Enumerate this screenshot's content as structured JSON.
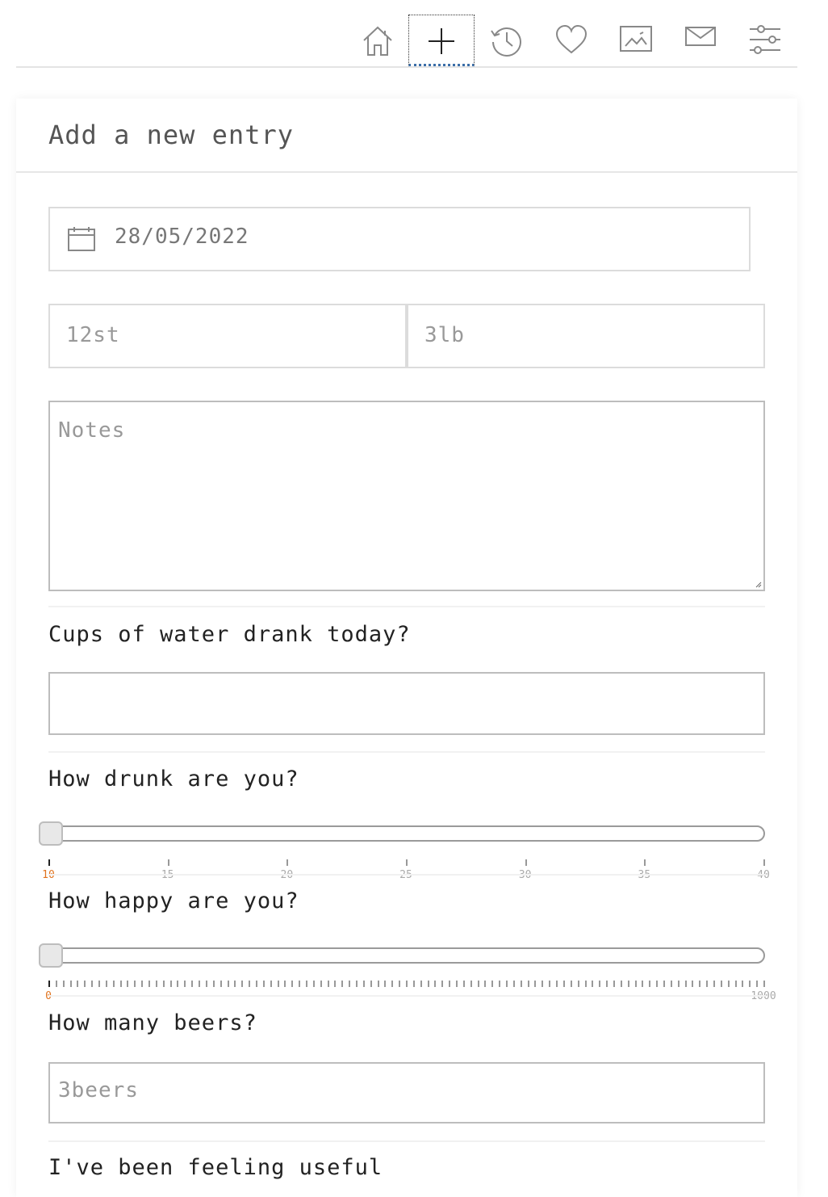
{
  "nav": {
    "items": [
      {
        "name": "home",
        "icon": "home-icon"
      },
      {
        "name": "add-entry",
        "icon": "plus-icon",
        "active": true
      },
      {
        "name": "history",
        "icon": "history-icon"
      },
      {
        "name": "favourites",
        "icon": "heart-icon"
      },
      {
        "name": "gallery",
        "icon": "image-icon"
      },
      {
        "name": "messages",
        "icon": "mail-icon"
      },
      {
        "name": "settings",
        "icon": "sliders-icon"
      }
    ]
  },
  "card": {
    "title": "Add a new entry"
  },
  "form": {
    "date_value": "28/05/2022",
    "stones_placeholder": "12st",
    "pounds_placeholder": "3lb",
    "notes_placeholder": "Notes",
    "water_question": "Cups of water drank today?",
    "water_value": "",
    "drunk_question": "How drunk are you?",
    "drunk_slider": {
      "min": 10,
      "max": 40,
      "value": 10,
      "tick_labels": [
        "10",
        "15",
        "20",
        "25",
        "30",
        "35",
        "40"
      ]
    },
    "happy_question": "How happy are you?",
    "happy_slider": {
      "min": 0,
      "max": 1000,
      "value": 0,
      "tick_labels": [
        "0",
        "1000"
      ]
    },
    "beers_question": "How many beers?",
    "beers_placeholder": "3beers",
    "useful_question": "I've been feeling useful"
  },
  "colors": {
    "accent": "#3b6ea8",
    "tick_highlight": "#e0731f",
    "border": "#bdbdbd"
  }
}
